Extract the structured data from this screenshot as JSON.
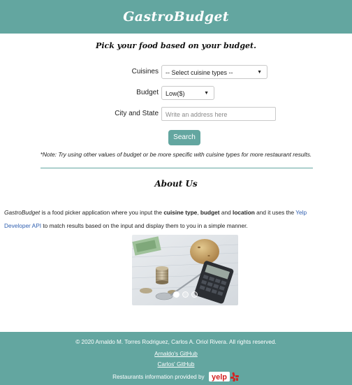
{
  "header": {
    "brand": "GastroBudget"
  },
  "form": {
    "tagline": "Pick your food based on your budget.",
    "cuisines_label": "Cuisines",
    "cuisines_value": "-- Select cuisine types --",
    "budget_label": "Budget",
    "budget_value": "Low($)",
    "city_label": "City and State",
    "city_placeholder": "Write an address here",
    "search_label": "Search",
    "note": "*Note: Try using other values of budget or be more specific with cuisine types for more restaurant results."
  },
  "about": {
    "title": "About Us",
    "p1_brand": "GastroBudget",
    "p1_a": " is a food picker application where you input the ",
    "p1_cuisine": "cuisine type",
    "p1_b": ", ",
    "p1_budget": "budget",
    "p1_c": " and ",
    "p1_location": "location",
    "p1_d": " and it uses the ",
    "p1_link_part1": "Yelp",
    "p1_link_part2": "Developer API",
    "p1_e": " to match results based on the input and display them to you in a simple manner."
  },
  "carousel": {
    "image_icon": "coins-potato-calculator-image",
    "slides": 3,
    "active_slide": 1
  },
  "footer": {
    "copyright": "© 2020 Arnaldo M. Torres Rodriguez, Carlos A. Oriol Rivera. All rights reserved.",
    "github1": "Arnaldo's GitHub",
    "github2": "Carlos' GitHub",
    "yelp_text": "Restaurants information provided by",
    "yelp_logo_text": "yelp"
  },
  "colors": {
    "accent": "#63a6a0",
    "link": "#2f5fb0",
    "yelp_red": "#d32323"
  }
}
